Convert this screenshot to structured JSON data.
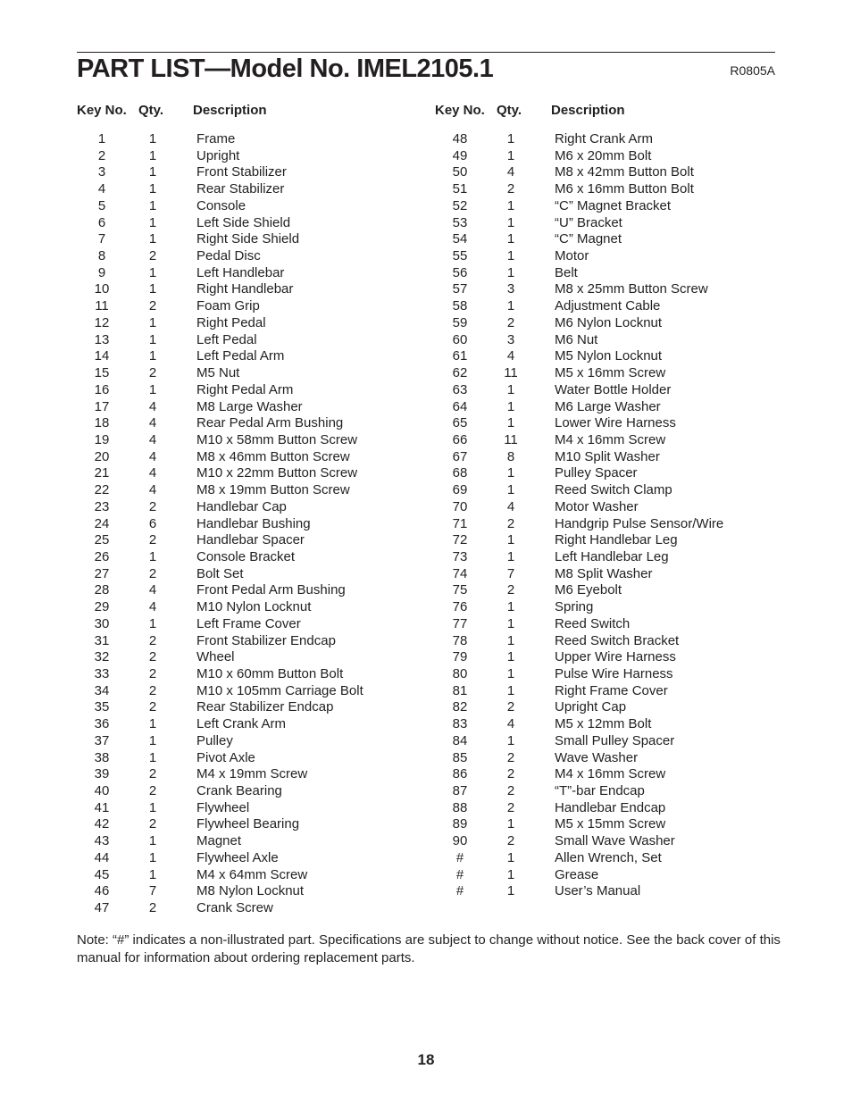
{
  "document": {
    "title": "PART LIST—Model No. IMEL2105.1",
    "code": "R0805A",
    "page_number": "18",
    "note": "Note: “#” indicates a non-illustrated part. Specifications are subject to change without notice. See the back cover of this manual for information about ordering replacement parts."
  },
  "headers": {
    "key": "Key No.",
    "qty": "Qty.",
    "desc": "Description"
  },
  "left_parts": [
    {
      "key": "1",
      "qty": "1",
      "desc": "Frame"
    },
    {
      "key": "2",
      "qty": "1",
      "desc": "Upright"
    },
    {
      "key": "3",
      "qty": "1",
      "desc": "Front Stabilizer"
    },
    {
      "key": "4",
      "qty": "1",
      "desc": "Rear Stabilizer"
    },
    {
      "key": "5",
      "qty": "1",
      "desc": "Console"
    },
    {
      "key": "6",
      "qty": "1",
      "desc": "Left Side Shield"
    },
    {
      "key": "7",
      "qty": "1",
      "desc": "Right Side Shield"
    },
    {
      "key": "8",
      "qty": "2",
      "desc": "Pedal Disc"
    },
    {
      "key": "9",
      "qty": "1",
      "desc": "Left Handlebar"
    },
    {
      "key": "10",
      "qty": "1",
      "desc": "Right Handlebar"
    },
    {
      "key": "11",
      "qty": "2",
      "desc": "Foam Grip"
    },
    {
      "key": "12",
      "qty": "1",
      "desc": "Right Pedal"
    },
    {
      "key": "13",
      "qty": "1",
      "desc": "Left Pedal"
    },
    {
      "key": "14",
      "qty": "1",
      "desc": "Left Pedal Arm"
    },
    {
      "key": "15",
      "qty": "2",
      "desc": "M5 Nut"
    },
    {
      "key": "16",
      "qty": "1",
      "desc": "Right Pedal Arm"
    },
    {
      "key": "17",
      "qty": "4",
      "desc": "M8 Large Washer"
    },
    {
      "key": "18",
      "qty": "4",
      "desc": "Rear Pedal Arm Bushing"
    },
    {
      "key": "19",
      "qty": "4",
      "desc": "M10 x 58mm Button Screw"
    },
    {
      "key": "20",
      "qty": "4",
      "desc": "M8 x 46mm Button Screw"
    },
    {
      "key": "21",
      "qty": "4",
      "desc": "M10 x 22mm Button Screw"
    },
    {
      "key": "22",
      "qty": "4",
      "desc": "M8 x 19mm Button Screw"
    },
    {
      "key": "23",
      "qty": "2",
      "desc": "Handlebar Cap"
    },
    {
      "key": "24",
      "qty": "6",
      "desc": "Handlebar Bushing"
    },
    {
      "key": "25",
      "qty": "2",
      "desc": "Handlebar Spacer"
    },
    {
      "key": "26",
      "qty": "1",
      "desc": "Console Bracket"
    },
    {
      "key": "27",
      "qty": "2",
      "desc": "Bolt Set"
    },
    {
      "key": "28",
      "qty": "4",
      "desc": "Front Pedal Arm Bushing"
    },
    {
      "key": "29",
      "qty": "4",
      "desc": "M10 Nylon Locknut"
    },
    {
      "key": "30",
      "qty": "1",
      "desc": "Left Frame Cover"
    },
    {
      "key": "31",
      "qty": "2",
      "desc": "Front Stabilizer Endcap"
    },
    {
      "key": "32",
      "qty": "2",
      "desc": "Wheel"
    },
    {
      "key": "33",
      "qty": "2",
      "desc": "M10 x 60mm Button Bolt"
    },
    {
      "key": "34",
      "qty": "2",
      "desc": "M10 x 105mm Carriage Bolt"
    },
    {
      "key": "35",
      "qty": "2",
      "desc": "Rear Stabilizer Endcap"
    },
    {
      "key": "36",
      "qty": "1",
      "desc": "Left Crank Arm"
    },
    {
      "key": "37",
      "qty": "1",
      "desc": "Pulley"
    },
    {
      "key": "38",
      "qty": "1",
      "desc": "Pivot Axle"
    },
    {
      "key": "39",
      "qty": "2",
      "desc": "M4 x 19mm Screw"
    },
    {
      "key": "40",
      "qty": "2",
      "desc": "Crank Bearing"
    },
    {
      "key": "41",
      "qty": "1",
      "desc": "Flywheel"
    },
    {
      "key": "42",
      "qty": "2",
      "desc": "Flywheel Bearing"
    },
    {
      "key": "43",
      "qty": "1",
      "desc": "Magnet"
    },
    {
      "key": "44",
      "qty": "1",
      "desc": "Flywheel Axle"
    },
    {
      "key": "45",
      "qty": "1",
      "desc": "M4 x 64mm Screw"
    },
    {
      "key": "46",
      "qty": "7",
      "desc": "M8 Nylon Locknut"
    },
    {
      "key": "47",
      "qty": "2",
      "desc": "Crank Screw"
    }
  ],
  "right_parts": [
    {
      "key": "48",
      "qty": "1",
      "desc": "Right Crank Arm"
    },
    {
      "key": "49",
      "qty": "1",
      "desc": "M6 x 20mm Bolt"
    },
    {
      "key": "50",
      "qty": "4",
      "desc": "M8 x 42mm Button Bolt"
    },
    {
      "key": "51",
      "qty": "2",
      "desc": "M6 x 16mm Button Bolt"
    },
    {
      "key": "52",
      "qty": "1",
      "desc": "“C” Magnet Bracket"
    },
    {
      "key": "53",
      "qty": "1",
      "desc": "“U” Bracket"
    },
    {
      "key": "54",
      "qty": "1",
      "desc": "“C” Magnet"
    },
    {
      "key": "55",
      "qty": "1",
      "desc": "Motor"
    },
    {
      "key": "56",
      "qty": "1",
      "desc": "Belt"
    },
    {
      "key": "57",
      "qty": "3",
      "desc": "M8 x 25mm Button Screw"
    },
    {
      "key": "58",
      "qty": "1",
      "desc": "Adjustment Cable"
    },
    {
      "key": "59",
      "qty": "2",
      "desc": "M6 Nylon Locknut"
    },
    {
      "key": "60",
      "qty": "3",
      "desc": "M6 Nut"
    },
    {
      "key": "61",
      "qty": "4",
      "desc": "M5 Nylon Locknut"
    },
    {
      "key": "62",
      "qty": "11",
      "desc": "M5 x 16mm Screw"
    },
    {
      "key": "63",
      "qty": "1",
      "desc": "Water Bottle Holder"
    },
    {
      "key": "64",
      "qty": "1",
      "desc": "M6 Large Washer"
    },
    {
      "key": "65",
      "qty": "1",
      "desc": "Lower Wire Harness"
    },
    {
      "key": "66",
      "qty": "11",
      "desc": "M4 x 16mm Screw"
    },
    {
      "key": "67",
      "qty": "8",
      "desc": "M10 Split Washer"
    },
    {
      "key": "68",
      "qty": "1",
      "desc": "Pulley Spacer"
    },
    {
      "key": "69",
      "qty": "1",
      "desc": "Reed Switch Clamp"
    },
    {
      "key": "70",
      "qty": "4",
      "desc": "Motor Washer"
    },
    {
      "key": "71",
      "qty": "2",
      "desc": "Handgrip Pulse Sensor/Wire"
    },
    {
      "key": "72",
      "qty": "1",
      "desc": "Right Handlebar Leg"
    },
    {
      "key": "73",
      "qty": "1",
      "desc": "Left Handlebar Leg"
    },
    {
      "key": "74",
      "qty": "7",
      "desc": "M8 Split Washer"
    },
    {
      "key": "75",
      "qty": "2",
      "desc": "M6 Eyebolt"
    },
    {
      "key": "76",
      "qty": "1",
      "desc": "Spring"
    },
    {
      "key": "77",
      "qty": "1",
      "desc": "Reed Switch"
    },
    {
      "key": "78",
      "qty": "1",
      "desc": "Reed Switch Bracket"
    },
    {
      "key": "79",
      "qty": "1",
      "desc": "Upper Wire Harness"
    },
    {
      "key": "80",
      "qty": "1",
      "desc": "Pulse Wire Harness"
    },
    {
      "key": "81",
      "qty": "1",
      "desc": "Right Frame Cover"
    },
    {
      "key": "82",
      "qty": "2",
      "desc": "Upright Cap"
    },
    {
      "key": "83",
      "qty": "4",
      "desc": "M5 x 12mm Bolt"
    },
    {
      "key": "84",
      "qty": "1",
      "desc": "Small Pulley Spacer"
    },
    {
      "key": "85",
      "qty": "2",
      "desc": "Wave Washer"
    },
    {
      "key": "86",
      "qty": "2",
      "desc": "M4 x 16mm Screw"
    },
    {
      "key": "87",
      "qty": "2",
      "desc": "“T”-bar Endcap"
    },
    {
      "key": "88",
      "qty": "2",
      "desc": "Handlebar Endcap"
    },
    {
      "key": "89",
      "qty": "1",
      "desc": "M5 x 15mm Screw"
    },
    {
      "key": "90",
      "qty": "2",
      "desc": "Small Wave Washer"
    },
    {
      "key": "#",
      "qty": "1",
      "desc": "Allen Wrench, Set"
    },
    {
      "key": "#",
      "qty": "1",
      "desc": "Grease"
    },
    {
      "key": "#",
      "qty": "1",
      "desc": "User’s Manual"
    }
  ]
}
